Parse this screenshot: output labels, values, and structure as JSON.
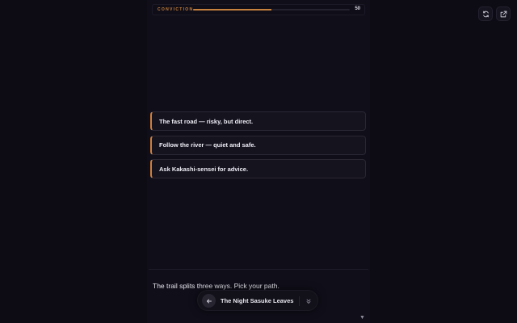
{
  "conviction": {
    "label": "CONVICTION",
    "value": "50",
    "progress": 0.5
  },
  "top_actions": [
    {
      "icon": "refresh-icon"
    },
    {
      "icon": "external-link-icon"
    }
  ],
  "choices": [
    {
      "label": "The fast road — risky, but direct."
    },
    {
      "label": "Follow the river — quiet and safe."
    },
    {
      "label": "Ask Kakashi-sensei for advice."
    }
  ],
  "narration": "The trail splits three ways. Pick your path.",
  "story_bar": {
    "title": "The Night Sasuke Leaves",
    "back_icon": "arrow-left-icon",
    "collapse_icon": "chevrons-down-icon"
  },
  "scroll_indicator": "▼",
  "colors": {
    "accent": "#c7813f",
    "background": "#0d0b14",
    "card": "#15131e"
  }
}
